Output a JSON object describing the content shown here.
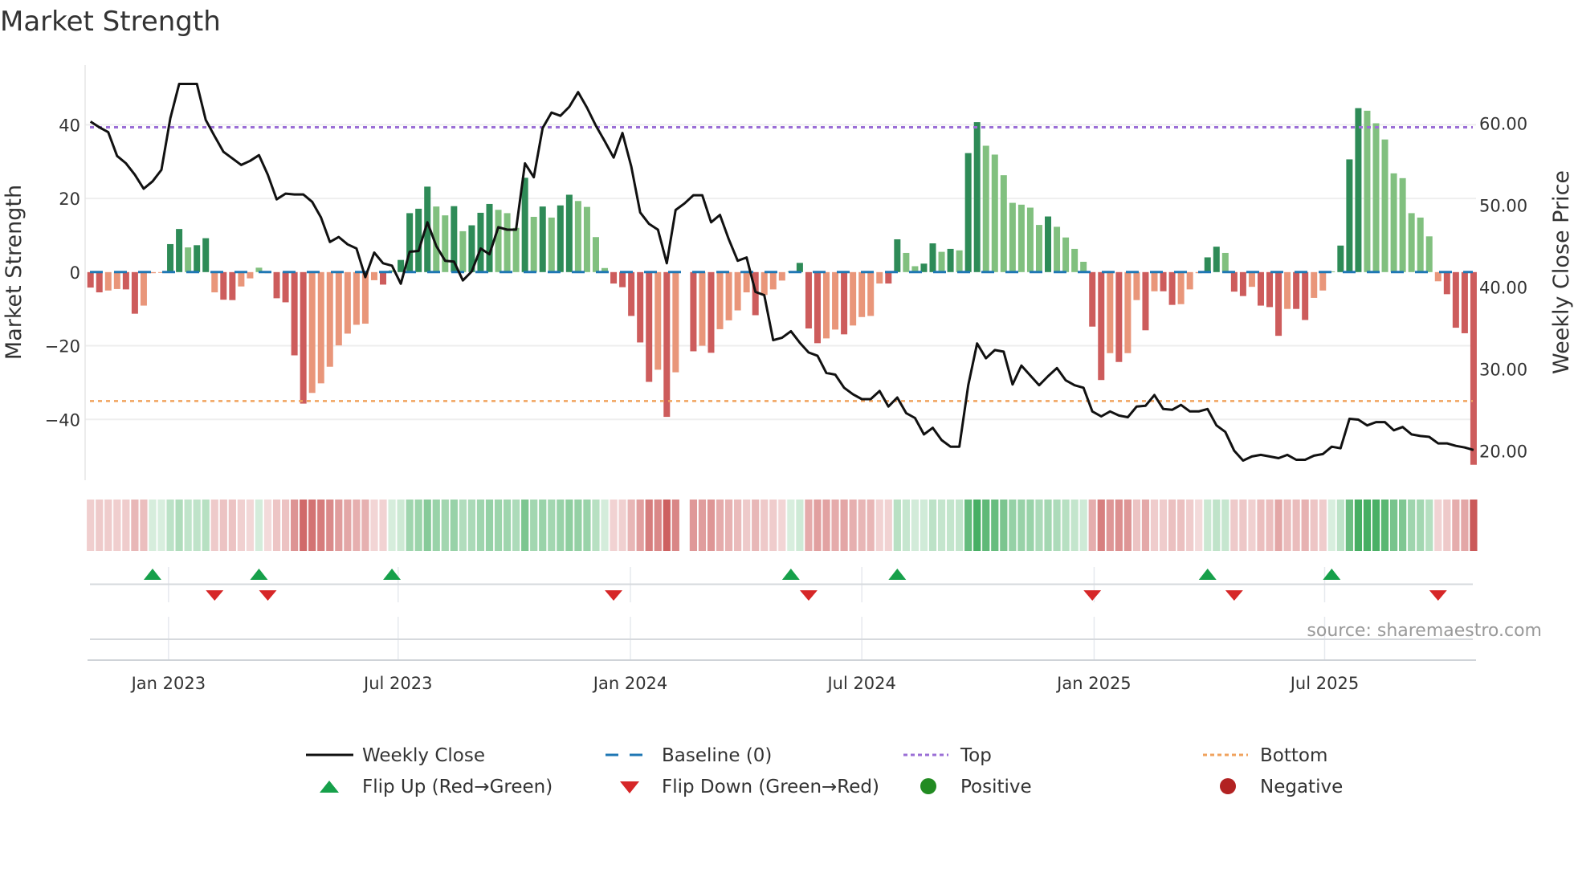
{
  "title": "Market Strength",
  "source": "source: sharemaestro.com",
  "colors": {
    "pos_dark": "#2e8b57",
    "pos_light": "#81c07f",
    "neg_dark": "#cd5c5c",
    "neg_light": "#e9967a",
    "baseline": "#1f77b4",
    "top": "#9b6fd6",
    "bottom": "#f0a35e",
    "price": "#111111",
    "flip_up": "#16a04a",
    "flip_down": "#d62728",
    "positive": "#228b22",
    "negative": "#b22222"
  },
  "legend": {
    "weekly_close": "Weekly Close",
    "baseline": "Baseline (0)",
    "top": "Top",
    "bottom": "Bottom",
    "flip_up": "Flip Up (Red→Green)",
    "flip_down": "Flip Down (Green→Red)",
    "positive": "Positive",
    "negative": "Negative"
  },
  "chart_data": {
    "type": "bar+line",
    "title": "Market Strength",
    "ylabel": "Market Strength",
    "y2label": "Weekly Close Price",
    "ylim": [
      -56.5,
      56.2
    ],
    "y2lim": [
      16.4,
      67.1
    ],
    "yticks": [
      {
        "v": 40,
        "label": "40"
      },
      {
        "v": 20,
        "label": "20"
      },
      {
        "v": 0,
        "label": "0"
      },
      {
        "v": -20,
        "label": "−20"
      },
      {
        "v": -40,
        "label": "−40"
      }
    ],
    "y2ticks": [
      {
        "v": 60,
        "label": "60.00"
      },
      {
        "v": 50,
        "label": "50.00"
      },
      {
        "v": 40,
        "label": "40.00"
      },
      {
        "v": 30,
        "label": "30.00"
      },
      {
        "v": 20,
        "label": "20.00"
      }
    ],
    "xticks": [
      {
        "week": 9.8,
        "label": "Jan 2023"
      },
      {
        "week": 35.7,
        "label": "Jul 2023"
      },
      {
        "week": 61.9,
        "label": "Jan 2024"
      },
      {
        "week": 88,
        "label": "Jul 2024"
      },
      {
        "week": 114.2,
        "label": "Jan 2025"
      },
      {
        "week": 140.2,
        "label": "Jul 2025"
      }
    ],
    "top_level": 39.3,
    "bottom_level": -35,
    "baseline": 0,
    "strength": [
      -4.2,
      -5.5,
      -5,
      -4.6,
      -4.7,
      -11.3,
      -9.1,
      -0.3,
      -0.2,
      7.6,
      11.7,
      6.7,
      7.3,
      9.2,
      -5.5,
      -7.5,
      -7.6,
      -3.9,
      -1.7,
      1.2,
      -0.3,
      -7.1,
      -8.2,
      -22.6,
      -35.7,
      -32.8,
      -30.2,
      -25.7,
      -19.9,
      -16.7,
      -14.3,
      -14,
      -2.2,
      -3.4,
      0.5,
      3.3,
      16,
      17.2,
      23.2,
      17.8,
      15.4,
      17.9,
      11.1,
      12.7,
      16.1,
      18.5,
      16.9,
      16,
      12,
      25.6,
      15,
      17.8,
      14.8,
      18.1,
      21,
      19.3,
      17.7,
      9.5,
      1.1,
      -3.1,
      -4.1,
      -11.9,
      -19.1,
      -29.8,
      -26.5,
      -39.3,
      -27.2,
      null,
      -21.5,
      -20,
      -21.9,
      -15.5,
      -13.1,
      -10.4,
      -5.5,
      -11.7,
      -6.2,
      -4.7,
      -2.3,
      0.2,
      2.5,
      -15.3,
      -19.3,
      -18,
      -15.6,
      -16.9,
      -14.5,
      -12.2,
      -11.9,
      -3.1,
      -3.1,
      8.9,
      5.2,
      1.6,
      2.3,
      7.8,
      5.5,
      6.3,
      5.9,
      32.3,
      40.7,
      34.3,
      31.9,
      26.3,
      18.8,
      18.3,
      17.5,
      12.8,
      15.1,
      12.3,
      9.4,
      6.3,
      2.8,
      -14.8,
      -29.3,
      -22,
      -24.4,
      -22,
      -7.6,
      -15.8,
      -5.2,
      -5.2,
      -8.9,
      -8.7,
      -4.7,
      -0.3,
      4,
      6.9,
      5.2,
      -5.3,
      -6.5,
      -4,
      -9.1,
      -9.5,
      -17.3,
      -10,
      -10,
      -13,
      -7,
      -5,
      0.2,
      7.2,
      30.6,
      44.5,
      43.8,
      40.4,
      36,
      26.8,
      25.5,
      16,
      14.8,
      9.7,
      -2.5,
      -6,
      -15.1,
      -16.6,
      -52.3
    ],
    "weekly_close": [
      60.2,
      59.5,
      58.9,
      56.0,
      55.1,
      53.7,
      52.0,
      52.9,
      54.3,
      60.6,
      64.8,
      64.8,
      64.8,
      60.4,
      58.4,
      56.5,
      55.7,
      54.9,
      55.4,
      56.1,
      53.7,
      50.7,
      51.4,
      51.3,
      51.3,
      50.4,
      48.5,
      45.5,
      46.1,
      45.2,
      44.7,
      41.2,
      44.2,
      42.9,
      42.6,
      40.4,
      44.3,
      44.4,
      47.9,
      45.0,
      43.2,
      43.1,
      40.8,
      41.9,
      44.7,
      44.0,
      47.3,
      47.0,
      47.0,
      55.1,
      53.4,
      59.4,
      61.3,
      60.9,
      62.0,
      63.8,
      61.9,
      59.7,
      57.8,
      55.8,
      58.8,
      54.7,
      49.1,
      47.7,
      47.0,
      42.9,
      49.4,
      50.2,
      51.2,
      51.2,
      47.9,
      48.8,
      45.8,
      43.2,
      43.6,
      39.4,
      39.0,
      33.5,
      33.8,
      34.6,
      33.2,
      32.0,
      31.6,
      29.5,
      29.3,
      27.7,
      26.9,
      26.3,
      26.3,
      27.3,
      25.4,
      26.5,
      24.6,
      24.0,
      22.0,
      22.8,
      21.3,
      20.5,
      20.5,
      28.0,
      33.1,
      31.3,
      32.3,
      32.1,
      28.1,
      30.4,
      29.2,
      28.0,
      29.1,
      30.1,
      28.6,
      28.0,
      27.7,
      24.8,
      24.2,
      24.8,
      24.3,
      24.1,
      25.4,
      25.5,
      26.8,
      25.1,
      25.0,
      25.6,
      24.8,
      24.8,
      25.1,
      23.1,
      22.3,
      20.0,
      18.8,
      19.3,
      19.5,
      19.3,
      19.1,
      19.5,
      18.9,
      18.9,
      19.4,
      19.6,
      20.5,
      20.3,
      23.9,
      23.8,
      23.1,
      23.5,
      23.5,
      22.5,
      22.9,
      22.0,
      21.8,
      21.7,
      20.9,
      20.9,
      20.6,
      20.4,
      20.1
    ],
    "flip_up_weeks": [
      8,
      20,
      35,
      80,
      92,
      127,
      141
    ],
    "flip_down_weeks": [
      15,
      21,
      60,
      82,
      114,
      130,
      153
    ],
    "grid": true,
    "legend_placement": "bottom"
  }
}
